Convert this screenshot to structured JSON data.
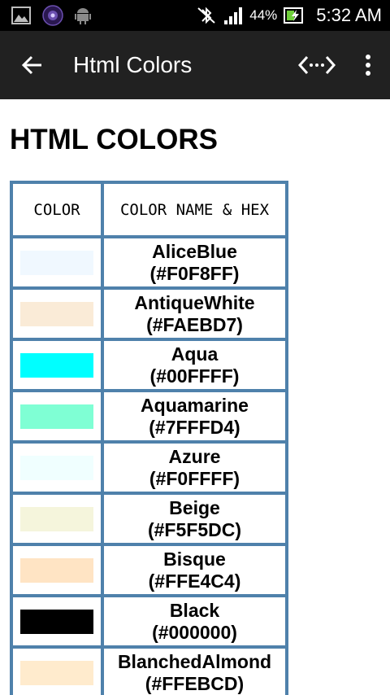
{
  "status_bar": {
    "icons_left": [
      "image-icon",
      "app-badge-icon",
      "android-icon"
    ],
    "icons_right": [
      "bluetooth-off-icon",
      "signal-icon",
      "battery-charging-icon"
    ],
    "battery": "44%",
    "time": "5:32 AM"
  },
  "app_bar": {
    "title": "Html Colors",
    "background": "#212121"
  },
  "page": {
    "heading": "HTML COLORS"
  },
  "table": {
    "headers": [
      "COLOR",
      "COLOR NAME & HEX"
    ],
    "border_color": "#4f81ab",
    "rows": [
      {
        "name": "AliceBlue",
        "hex": "(#F0F8FF)",
        "swatch": "#F0F8FF"
      },
      {
        "name": "AntiqueWhite",
        "hex": "(#FAEBD7)",
        "swatch": "#FAEBD7"
      },
      {
        "name": "Aqua",
        "hex": "(#00FFFF)",
        "swatch": "#00FFFF"
      },
      {
        "name": "Aquamarine",
        "hex": "(#7FFFD4)",
        "swatch": "#7FFFD4"
      },
      {
        "name": "Azure",
        "hex": "(#F0FFFF)",
        "swatch": "#F0FFFF"
      },
      {
        "name": "Beige",
        "hex": "(#F5F5DC)",
        "swatch": "#F5F5DC"
      },
      {
        "name": "Bisque",
        "hex": "(#FFE4C4)",
        "swatch": "#FFE4C4"
      },
      {
        "name": "Black",
        "hex": "(#000000)",
        "swatch": "#000000"
      },
      {
        "name": "BlanchedAlmond",
        "hex": "(#FFEBCD)",
        "swatch": "#FFEBCD"
      }
    ]
  }
}
